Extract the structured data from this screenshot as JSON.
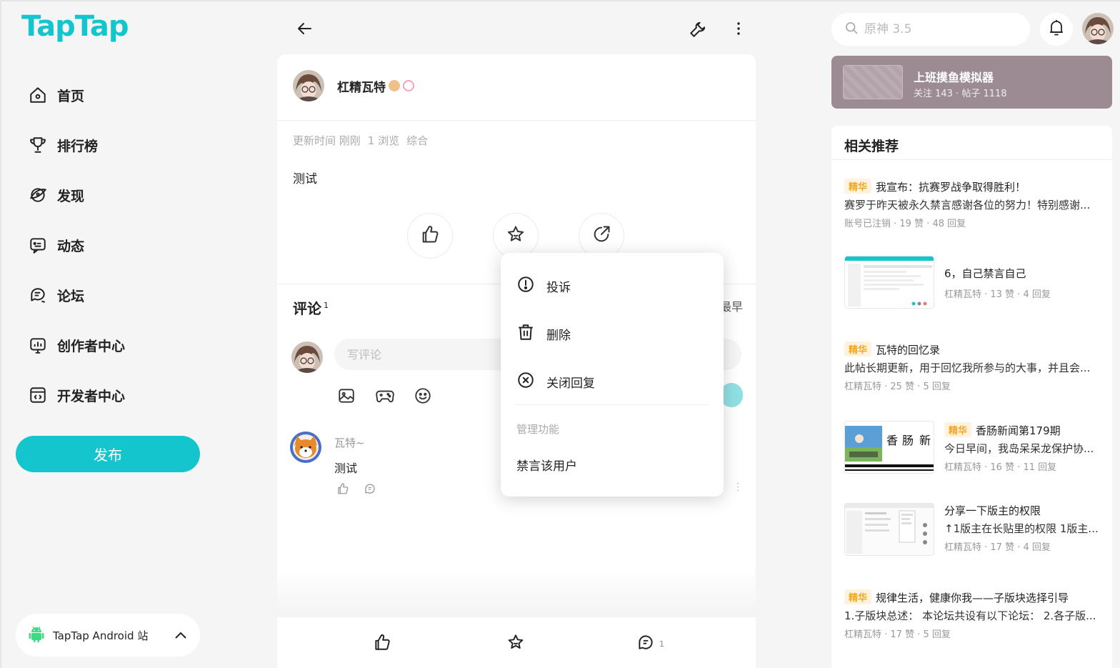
{
  "app": {
    "logo": "TapTap"
  },
  "sidebar": {
    "items": [
      {
        "label": "首页",
        "icon": "home-icon"
      },
      {
        "label": "排行榜",
        "icon": "trophy-icon"
      },
      {
        "label": "发现",
        "icon": "discover-icon"
      },
      {
        "label": "动态",
        "icon": "feed-icon"
      },
      {
        "label": "论坛",
        "icon": "forum-icon"
      },
      {
        "label": "创作者中心",
        "icon": "creator-icon"
      },
      {
        "label": "开发者中心",
        "icon": "developer-icon"
      }
    ],
    "publish_label": "发布",
    "android_label": "TapTap Android 站"
  },
  "post": {
    "author": "杠精瓦特",
    "meta": {
      "updated": "更新时间 刚刚",
      "views": "1 浏览",
      "category": "综合"
    },
    "body": "测试"
  },
  "comments": {
    "title": "评论",
    "count": "1",
    "sort_partial": "最早",
    "input_placeholder": "写评论",
    "items": [
      {
        "name": "瓦特~",
        "text": "测试"
      }
    ]
  },
  "bottom_bar": {
    "comment_count": "1"
  },
  "popup": {
    "items": [
      {
        "label": "投诉",
        "icon": "report-icon"
      },
      {
        "label": "删除",
        "icon": "trash-icon"
      },
      {
        "label": "关闭回复",
        "icon": "close-reply-icon"
      }
    ],
    "section": "管理功能",
    "mute_label": "禁言该用户"
  },
  "search": {
    "placeholder": "原神 3.5"
  },
  "forum": {
    "name": "上班摸鱼模拟器",
    "stats": "关注 143 · 帖子 1118"
  },
  "recommend": {
    "title": "相关推荐",
    "tag": "精华",
    "items": [
      {
        "featured": true,
        "title": "我宣布：抗赛罗战争取得胜利！",
        "sub": "赛罗于昨天被永久禁言感谢各位的努力！特别感谢...",
        "meta": "账号已注销 · 19 赞 · 48 回复"
      },
      {
        "featured": false,
        "title": "6，自己禁言自己",
        "sub": "",
        "meta": "杠精瓦特 · 13 赞 · 4 回复"
      },
      {
        "featured": true,
        "title": "瓦特的回忆录",
        "sub": "此帖长期更新，用于回忆我所参与的大事，并且会...",
        "meta": "杠精瓦特 · 25 赞 · 5 回复"
      },
      {
        "featured": true,
        "title": "香肠新闻第179期",
        "sub": "今日早间，我岛呆呆龙保护协...",
        "meta": "杠精瓦特 · 16 赞 · 11 回复"
      },
      {
        "featured": false,
        "title": "分享一下版主的权限",
        "sub": "↑1版主在长贴里的权限 1版主...",
        "meta": "杠精瓦特 · 17 赞 · 4 回复"
      },
      {
        "featured": true,
        "title": "规律生活，健康你我——子版块选择引导",
        "sub": "1.子版块总述： 本论坛共设有以下论坛： 2.各子版...",
        "meta": "杠精瓦特 · 17 赞 · 5 回复"
      }
    ]
  },
  "colors": {
    "accent": "#15c5ce",
    "featured": "#f2a81e",
    "forum_bg": "#9c8b92"
  }
}
